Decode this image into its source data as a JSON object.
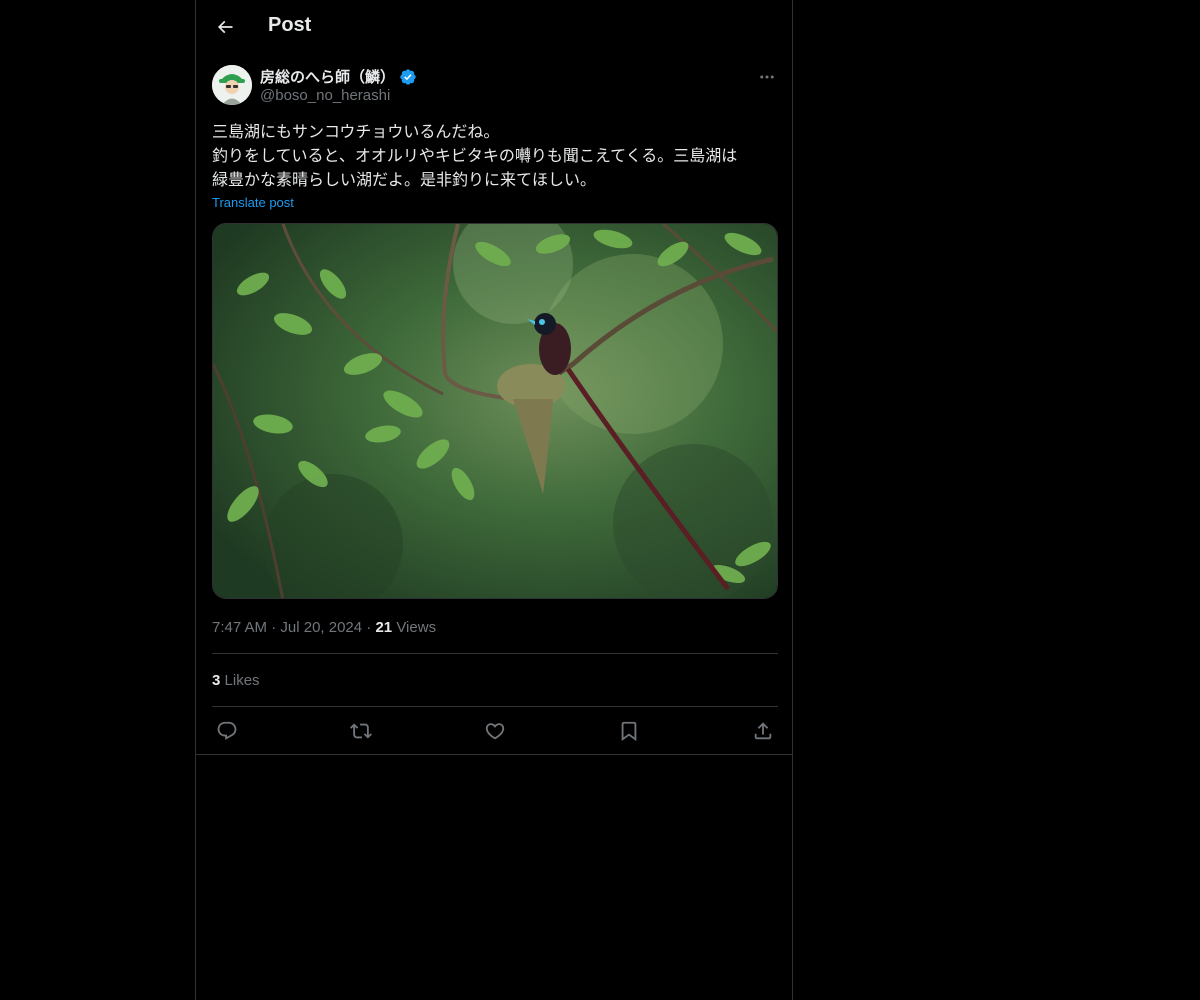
{
  "header": {
    "title": "Post",
    "back_icon": "arrow-left-icon"
  },
  "author": {
    "display_name": "房総のへら師（鱗）",
    "handle": "@boso_no_herashi",
    "verified": true,
    "badge_color": "#1d9bf0"
  },
  "post": {
    "text_lines": [
      "三島湖にもサンコウチョウいるんだね。",
      "釣りをしていると、オオルリやキビタキの囀りも聞こえてくる。三島湖は",
      "緑豊かな素晴らしい湖だよ。是非釣りに来てほしい。"
    ],
    "translate_label": "Translate post",
    "time": "7:47 AM",
    "date": "Jul 20, 2024",
    "views_count": "21",
    "views_label": "Views",
    "likes_count": "3",
    "likes_label": "Likes"
  },
  "actions": [
    {
      "icon": "reply-icon"
    },
    {
      "icon": "retweet-icon"
    },
    {
      "icon": "like-icon"
    },
    {
      "icon": "bookmark-icon"
    },
    {
      "icon": "share-icon"
    }
  ],
  "colors": {
    "background": "#000000",
    "text": "#e7e9ea",
    "muted": "#71767b",
    "border": "#2f3336",
    "link": "#1d9bf0"
  }
}
